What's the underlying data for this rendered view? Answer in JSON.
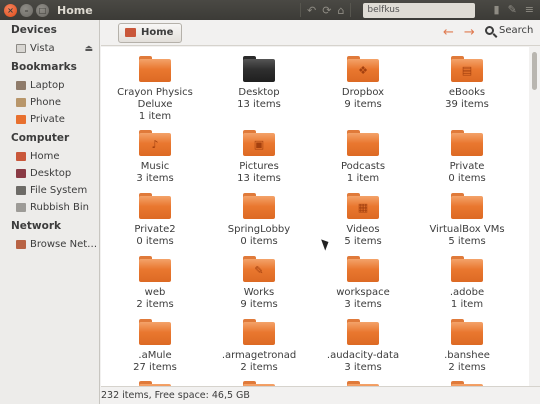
{
  "window": {
    "title": "Home"
  },
  "topbar": {
    "search_text": "belfkus"
  },
  "sidebar": {
    "sections": [
      {
        "heading": "Devices",
        "items": [
          {
            "label": "Vista",
            "icon": "drive-icon",
            "eject": true
          }
        ]
      },
      {
        "heading": "Bookmarks",
        "items": [
          {
            "label": "Laptop",
            "icon": "laptop-icon"
          },
          {
            "label": "Phone",
            "icon": "phone-icon"
          },
          {
            "label": "Private",
            "icon": "folder-icon"
          }
        ]
      },
      {
        "heading": "Computer",
        "items": [
          {
            "label": "Home",
            "icon": "home-icon"
          },
          {
            "label": "Desktop",
            "icon": "desktop-icon"
          },
          {
            "label": "File System",
            "icon": "filesystem-icon"
          },
          {
            "label": "Rubbish Bin",
            "icon": "trash-icon"
          }
        ]
      },
      {
        "heading": "Network",
        "items": [
          {
            "label": "Browse Net…",
            "icon": "network-icon"
          }
        ]
      }
    ]
  },
  "location": {
    "crumb": "Home",
    "search_label": "Search"
  },
  "items": [
    {
      "name": "Crayon Physics Deluxe",
      "count": "1 item",
      "kind": "folder"
    },
    {
      "name": "Desktop",
      "count": "13 items",
      "kind": "folder-dark"
    },
    {
      "name": "Dropbox",
      "count": "9 items",
      "kind": "folder",
      "glyph": "❖"
    },
    {
      "name": "eBooks",
      "count": "39 items",
      "kind": "folder",
      "glyph": "▤"
    },
    {
      "name": "Music",
      "count": "3 items",
      "kind": "folder",
      "glyph": "♪"
    },
    {
      "name": "Pictures",
      "count": "13 items",
      "kind": "folder",
      "glyph": "▣"
    },
    {
      "name": "Podcasts",
      "count": "1 item",
      "kind": "folder"
    },
    {
      "name": "Private",
      "count": "0 items",
      "kind": "folder"
    },
    {
      "name": "Private2",
      "count": "0 items",
      "kind": "folder"
    },
    {
      "name": "SpringLobby",
      "count": "0 items",
      "kind": "folder"
    },
    {
      "name": "Videos",
      "count": "5 items",
      "kind": "folder",
      "glyph": "▦"
    },
    {
      "name": "VirtualBox VMs",
      "count": "5 items",
      "kind": "folder"
    },
    {
      "name": "web",
      "count": "2 items",
      "kind": "folder"
    },
    {
      "name": "Works",
      "count": "9 items",
      "kind": "folder",
      "glyph": "✎"
    },
    {
      "name": "workspace",
      "count": "3 items",
      "kind": "folder"
    },
    {
      "name": ".adobe",
      "count": "1 item",
      "kind": "folder"
    },
    {
      "name": ".aMule",
      "count": "27 items",
      "kind": "folder"
    },
    {
      "name": ".armagetronad",
      "count": "2 items",
      "kind": "folder"
    },
    {
      "name": ".audacity-data",
      "count": "3 items",
      "kind": "folder"
    },
    {
      "name": ".banshee",
      "count": "2 items",
      "kind": "folder"
    },
    {
      "name": "",
      "count": "",
      "kind": "folder"
    },
    {
      "name": "",
      "count": "",
      "kind": "folder"
    },
    {
      "name": "",
      "count": "",
      "kind": "folder"
    },
    {
      "name": "",
      "count": "",
      "kind": "folder"
    }
  ],
  "status": {
    "text": "232 items, Free space: 46,5 GB"
  }
}
